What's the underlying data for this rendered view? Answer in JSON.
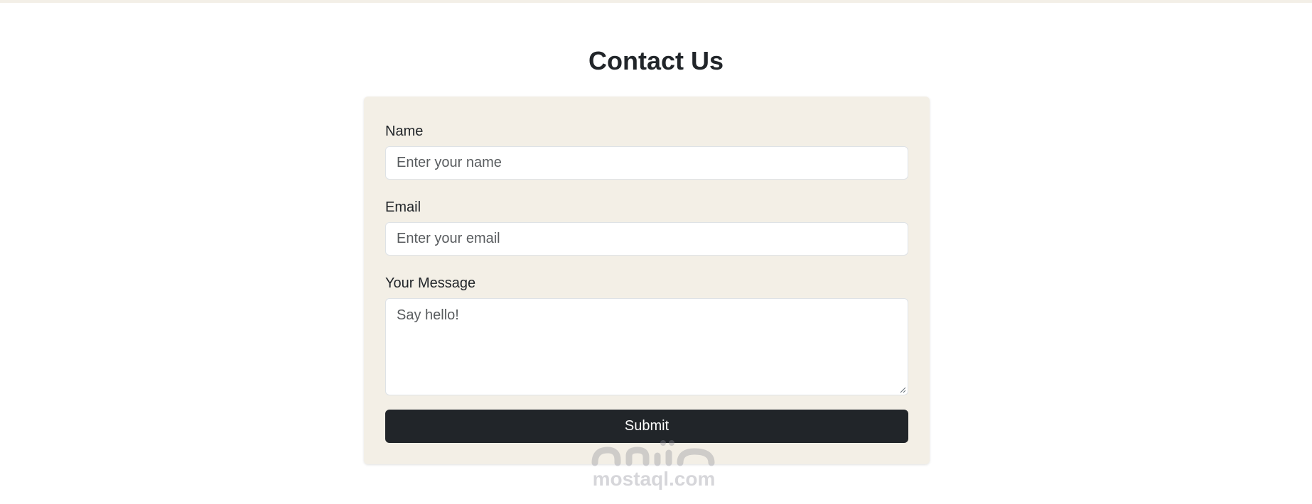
{
  "page": {
    "title": "Contact Us"
  },
  "form": {
    "name": {
      "label": "Name",
      "placeholder": "Enter your name",
      "value": ""
    },
    "email": {
      "label": "Email",
      "placeholder": "Enter your email",
      "value": ""
    },
    "message": {
      "label": "Your Message",
      "placeholder": "Say hello!",
      "value": ""
    },
    "submit_label": "Submit"
  },
  "watermark": {
    "text": "mostaql.com"
  },
  "colors": {
    "card_background": "#f3efe6",
    "button_background": "#212529",
    "button_text": "#ffffff",
    "text": "#212529"
  }
}
